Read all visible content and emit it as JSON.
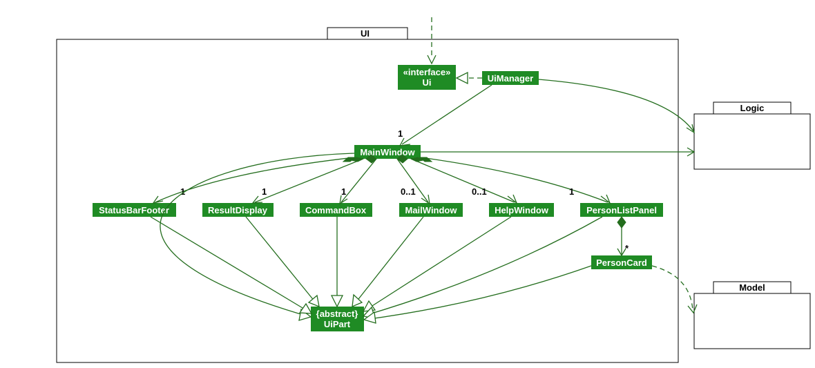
{
  "diagram": {
    "type": "UML class diagram",
    "packages": {
      "ui": {
        "label": "UI"
      },
      "logic": {
        "label": "Logic"
      },
      "model": {
        "label": "Model"
      }
    },
    "classes": {
      "ui_interface": {
        "stereotype": "«interface»",
        "name": "Ui"
      },
      "ui_manager": {
        "name": "UiManager"
      },
      "main_window": {
        "name": "MainWindow"
      },
      "status_bar_footer": {
        "name": "StatusBarFooter"
      },
      "result_display": {
        "name": "ResultDisplay"
      },
      "command_box": {
        "name": "CommandBox"
      },
      "mail_window": {
        "name": "MailWindow"
      },
      "help_window": {
        "name": "HelpWindow"
      },
      "person_list_panel": {
        "name": "PersonListPanel"
      },
      "person_card": {
        "name": "PersonCard"
      },
      "ui_part": {
        "stereotype": "{abstract}",
        "name": "UiPart"
      }
    },
    "multiplicities": {
      "mw_to_main": "1",
      "mw_sbf": "1",
      "mw_rd": "1",
      "mw_cb": "1",
      "mw_mailw": "0..1",
      "mw_hw": "0..1",
      "mw_plp": "1",
      "plp_pc": "*"
    },
    "relationships": [
      {
        "from": "external-top",
        "to": "Ui",
        "type": "dependency"
      },
      {
        "from": "UiManager",
        "to": "Ui",
        "type": "realization"
      },
      {
        "from": "UiManager",
        "to": "MainWindow",
        "type": "association",
        "mult": "1"
      },
      {
        "from": "MainWindow",
        "to": "StatusBarFooter",
        "type": "composition",
        "mult": "1"
      },
      {
        "from": "MainWindow",
        "to": "ResultDisplay",
        "type": "composition",
        "mult": "1"
      },
      {
        "from": "MainWindow",
        "to": "CommandBox",
        "type": "composition",
        "mult": "1"
      },
      {
        "from": "MainWindow",
        "to": "MailWindow",
        "type": "composition",
        "mult": "0..1"
      },
      {
        "from": "MainWindow",
        "to": "HelpWindow",
        "type": "composition",
        "mult": "0..1"
      },
      {
        "from": "MainWindow",
        "to": "PersonListPanel",
        "type": "composition",
        "mult": "1"
      },
      {
        "from": "PersonListPanel",
        "to": "PersonCard",
        "type": "composition",
        "mult": "*"
      },
      {
        "from": "MainWindow",
        "to": "UiPart",
        "type": "generalization"
      },
      {
        "from": "StatusBarFooter",
        "to": "UiPart",
        "type": "generalization"
      },
      {
        "from": "ResultDisplay",
        "to": "UiPart",
        "type": "generalization"
      },
      {
        "from": "CommandBox",
        "to": "UiPart",
        "type": "generalization"
      },
      {
        "from": "MailWindow",
        "to": "UiPart",
        "type": "generalization"
      },
      {
        "from": "HelpWindow",
        "to": "UiPart",
        "type": "generalization"
      },
      {
        "from": "PersonListPanel",
        "to": "UiPart",
        "type": "generalization"
      },
      {
        "from": "PersonCard",
        "to": "UiPart",
        "type": "generalization"
      },
      {
        "from": "MainWindow",
        "to": "Logic",
        "type": "association"
      },
      {
        "from": "UiManager",
        "to": "Logic",
        "type": "association"
      },
      {
        "from": "PersonCard",
        "to": "Model",
        "type": "dependency"
      }
    ]
  }
}
